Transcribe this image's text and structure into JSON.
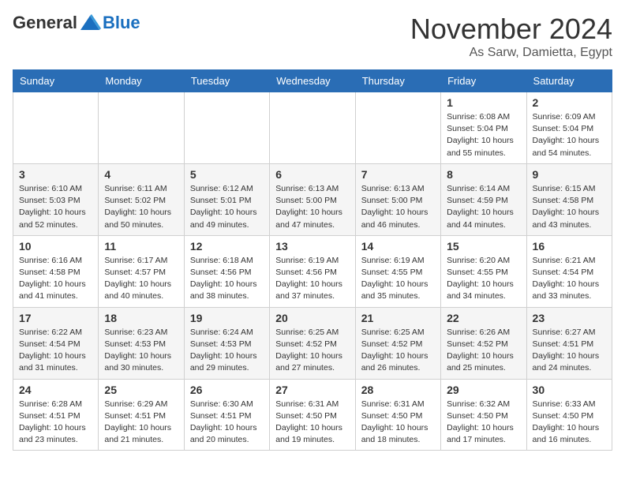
{
  "logo": {
    "general": "General",
    "blue": "Blue"
  },
  "title": {
    "month_year": "November 2024",
    "location": "As Sarw, Damietta, Egypt"
  },
  "headers": [
    "Sunday",
    "Monday",
    "Tuesday",
    "Wednesday",
    "Thursday",
    "Friday",
    "Saturday"
  ],
  "weeks": [
    [
      {
        "day": "",
        "info": ""
      },
      {
        "day": "",
        "info": ""
      },
      {
        "day": "",
        "info": ""
      },
      {
        "day": "",
        "info": ""
      },
      {
        "day": "",
        "info": ""
      },
      {
        "day": "1",
        "info": "Sunrise: 6:08 AM\nSunset: 5:04 PM\nDaylight: 10 hours and 55 minutes."
      },
      {
        "day": "2",
        "info": "Sunrise: 6:09 AM\nSunset: 5:04 PM\nDaylight: 10 hours and 54 minutes."
      }
    ],
    [
      {
        "day": "3",
        "info": "Sunrise: 6:10 AM\nSunset: 5:03 PM\nDaylight: 10 hours and 52 minutes."
      },
      {
        "day": "4",
        "info": "Sunrise: 6:11 AM\nSunset: 5:02 PM\nDaylight: 10 hours and 50 minutes."
      },
      {
        "day": "5",
        "info": "Sunrise: 6:12 AM\nSunset: 5:01 PM\nDaylight: 10 hours and 49 minutes."
      },
      {
        "day": "6",
        "info": "Sunrise: 6:13 AM\nSunset: 5:00 PM\nDaylight: 10 hours and 47 minutes."
      },
      {
        "day": "7",
        "info": "Sunrise: 6:13 AM\nSunset: 5:00 PM\nDaylight: 10 hours and 46 minutes."
      },
      {
        "day": "8",
        "info": "Sunrise: 6:14 AM\nSunset: 4:59 PM\nDaylight: 10 hours and 44 minutes."
      },
      {
        "day": "9",
        "info": "Sunrise: 6:15 AM\nSunset: 4:58 PM\nDaylight: 10 hours and 43 minutes."
      }
    ],
    [
      {
        "day": "10",
        "info": "Sunrise: 6:16 AM\nSunset: 4:58 PM\nDaylight: 10 hours and 41 minutes."
      },
      {
        "day": "11",
        "info": "Sunrise: 6:17 AM\nSunset: 4:57 PM\nDaylight: 10 hours and 40 minutes."
      },
      {
        "day": "12",
        "info": "Sunrise: 6:18 AM\nSunset: 4:56 PM\nDaylight: 10 hours and 38 minutes."
      },
      {
        "day": "13",
        "info": "Sunrise: 6:19 AM\nSunset: 4:56 PM\nDaylight: 10 hours and 37 minutes."
      },
      {
        "day": "14",
        "info": "Sunrise: 6:19 AM\nSunset: 4:55 PM\nDaylight: 10 hours and 35 minutes."
      },
      {
        "day": "15",
        "info": "Sunrise: 6:20 AM\nSunset: 4:55 PM\nDaylight: 10 hours and 34 minutes."
      },
      {
        "day": "16",
        "info": "Sunrise: 6:21 AM\nSunset: 4:54 PM\nDaylight: 10 hours and 33 minutes."
      }
    ],
    [
      {
        "day": "17",
        "info": "Sunrise: 6:22 AM\nSunset: 4:54 PM\nDaylight: 10 hours and 31 minutes."
      },
      {
        "day": "18",
        "info": "Sunrise: 6:23 AM\nSunset: 4:53 PM\nDaylight: 10 hours and 30 minutes."
      },
      {
        "day": "19",
        "info": "Sunrise: 6:24 AM\nSunset: 4:53 PM\nDaylight: 10 hours and 29 minutes."
      },
      {
        "day": "20",
        "info": "Sunrise: 6:25 AM\nSunset: 4:52 PM\nDaylight: 10 hours and 27 minutes."
      },
      {
        "day": "21",
        "info": "Sunrise: 6:25 AM\nSunset: 4:52 PM\nDaylight: 10 hours and 26 minutes."
      },
      {
        "day": "22",
        "info": "Sunrise: 6:26 AM\nSunset: 4:52 PM\nDaylight: 10 hours and 25 minutes."
      },
      {
        "day": "23",
        "info": "Sunrise: 6:27 AM\nSunset: 4:51 PM\nDaylight: 10 hours and 24 minutes."
      }
    ],
    [
      {
        "day": "24",
        "info": "Sunrise: 6:28 AM\nSunset: 4:51 PM\nDaylight: 10 hours and 23 minutes."
      },
      {
        "day": "25",
        "info": "Sunrise: 6:29 AM\nSunset: 4:51 PM\nDaylight: 10 hours and 21 minutes."
      },
      {
        "day": "26",
        "info": "Sunrise: 6:30 AM\nSunset: 4:51 PM\nDaylight: 10 hours and 20 minutes."
      },
      {
        "day": "27",
        "info": "Sunrise: 6:31 AM\nSunset: 4:50 PM\nDaylight: 10 hours and 19 minutes."
      },
      {
        "day": "28",
        "info": "Sunrise: 6:31 AM\nSunset: 4:50 PM\nDaylight: 10 hours and 18 minutes."
      },
      {
        "day": "29",
        "info": "Sunrise: 6:32 AM\nSunset: 4:50 PM\nDaylight: 10 hours and 17 minutes."
      },
      {
        "day": "30",
        "info": "Sunrise: 6:33 AM\nSunset: 4:50 PM\nDaylight: 10 hours and 16 minutes."
      }
    ]
  ]
}
